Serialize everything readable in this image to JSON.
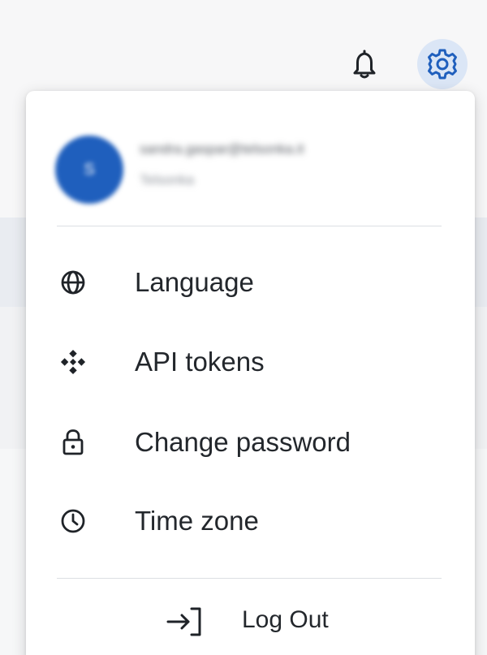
{
  "header": {
    "notifications_icon": "bell-icon",
    "settings_icon": "gear-icon",
    "settings_button_bg": "#dbe6f6",
    "settings_icon_color": "#1f5fbd"
  },
  "profile": {
    "avatar_initial": "S",
    "avatar_color": "#1f5fbd",
    "email": "sandra.gaspar@telsonka.it",
    "organization": "Telsonka"
  },
  "menu": {
    "items": [
      {
        "label": "Language",
        "icon": "globe-icon"
      },
      {
        "label": "API tokens",
        "icon": "api-token-icon"
      },
      {
        "label": "Change password",
        "icon": "lock-icon"
      },
      {
        "label": "Time zone",
        "icon": "clock-icon"
      }
    ],
    "logout": {
      "label": "Log Out",
      "icon": "logout-icon"
    }
  }
}
